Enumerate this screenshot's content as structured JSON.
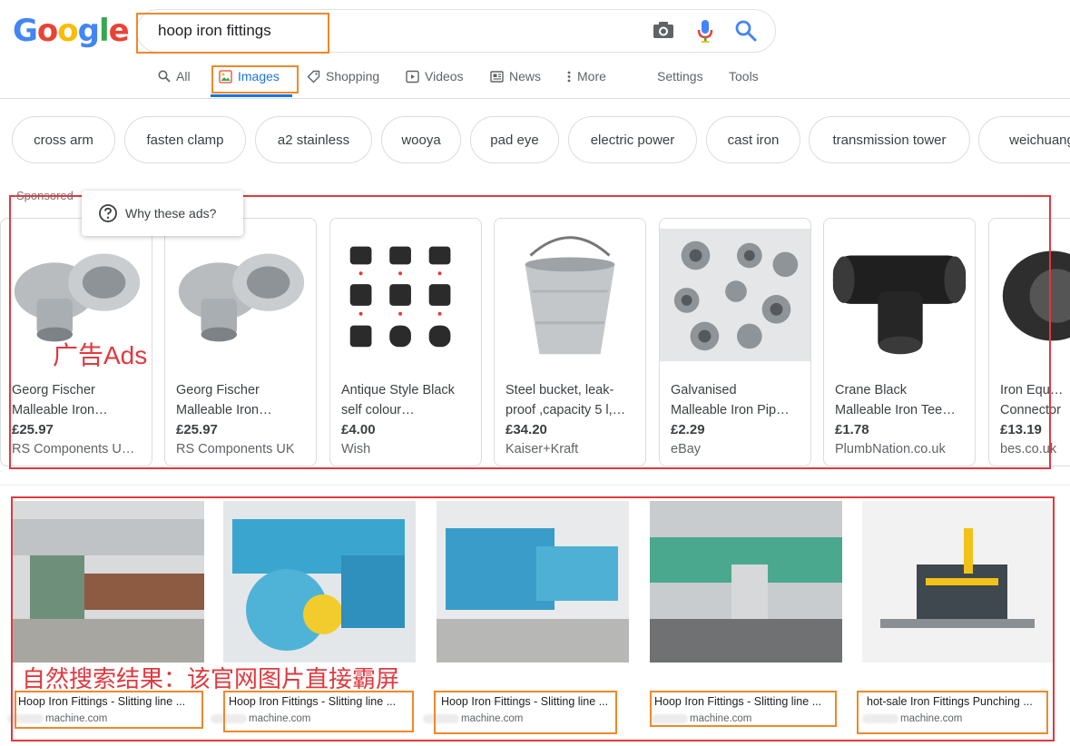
{
  "search": {
    "query": "hoop iron fittings"
  },
  "logo": {
    "letters": [
      "G",
      "o",
      "o",
      "g",
      "l",
      "e"
    ],
    "colors": [
      "#4285F4",
      "#EA4335",
      "#FBBC05",
      "#4285F4",
      "#34A853",
      "#EA4335"
    ]
  },
  "tabs": [
    {
      "label": "All",
      "icon": "search-icon"
    },
    {
      "label": "Images",
      "icon": "image-icon",
      "active": true
    },
    {
      "label": "Shopping",
      "icon": "tag-icon"
    },
    {
      "label": "Videos",
      "icon": "play-icon"
    },
    {
      "label": "News",
      "icon": "news-icon"
    },
    {
      "label": "More",
      "icon": "dots-vertical-icon"
    },
    {
      "label": "Settings"
    },
    {
      "label": "Tools"
    }
  ],
  "chips": [
    "cross arm",
    "fasten clamp",
    "a2 stainless",
    "wooya",
    "pad eye",
    "electric power",
    "cast iron",
    "transmission tower",
    "weichuang"
  ],
  "sponsored": {
    "label": "Sponsored",
    "why_ads": "Why these ads?",
    "annotation": "广告Ads",
    "items": [
      {
        "title1": "Georg Fischer",
        "title2": "Malleable Iron…",
        "price": "£25.97",
        "store": "RS Components U…"
      },
      {
        "title1": "Georg Fischer",
        "title2": "Malleable Iron…",
        "price": "£25.97",
        "store": "RS Components UK"
      },
      {
        "title1": "Antique Style Black",
        "title2": "self colour…",
        "price": "£4.00",
        "store": "Wish"
      },
      {
        "title1": "Steel bucket, leak-",
        "title2": "proof ,capacity 5 l,…",
        "price": "£34.20",
        "store": "Kaiser+Kraft"
      },
      {
        "title1": "Galvanised",
        "title2": "Malleable Iron Pip…",
        "price": "£2.29",
        "store": "eBay"
      },
      {
        "title1": "Crane Black",
        "title2": "Malleable Iron Tee…",
        "price": "£1.78",
        "store": "PlumbNation.co.uk"
      },
      {
        "title1": "Iron Equal U",
        "title2": "Connector",
        "price": "£13.19",
        "store": "bes.co.uk"
      }
    ]
  },
  "organic": {
    "annotation": "自然搜索结果：该官网图片直接霸屏",
    "items": [
      {
        "title": "Hoop Iron Fittings - Slitting line ...",
        "site": "machine.com"
      },
      {
        "title": "Hoop Iron Fittings - Slitting line ...",
        "site": "machine.com"
      },
      {
        "title": "Hoop Iron Fittings - Slitting line ...",
        "site": "machine.com"
      },
      {
        "title": "Hoop Iron Fittings - Slitting line ...",
        "site": "machine.com"
      },
      {
        "title": "hot-sale Iron Fittings Punching ...",
        "site": "machine.com"
      }
    ]
  }
}
